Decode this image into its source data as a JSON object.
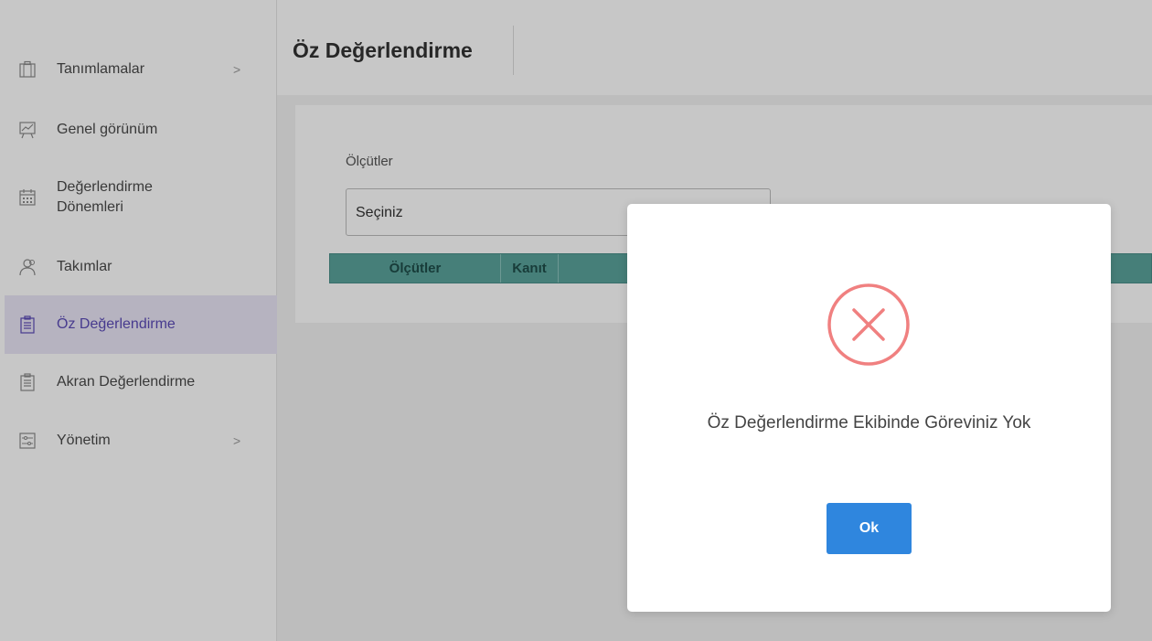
{
  "sidebar": {
    "items": [
      {
        "label": "Tanımlamalar",
        "icon": "briefcase-icon",
        "has_chevron": true
      },
      {
        "label": "Genel görünüm",
        "icon": "chart-board-icon",
        "has_chevron": false
      },
      {
        "label": "Değerlendirme Dönemleri",
        "icon": "calendar-icon",
        "has_chevron": false
      },
      {
        "label": "Takımlar",
        "icon": "team-icon",
        "has_chevron": false
      },
      {
        "label": "Öz Değerlendirme",
        "icon": "clipboard-list-icon",
        "has_chevron": false,
        "active": true
      },
      {
        "label": "Akran Değerlendirme",
        "icon": "clipboard-list-icon",
        "has_chevron": false
      },
      {
        "label": "Yönetim",
        "icon": "sliders-icon",
        "has_chevron": true
      }
    ],
    "chevron": ">"
  },
  "header": {
    "title": "Öz Değerlendirme"
  },
  "form": {
    "field_label": "Ölçütler",
    "select_value": "Seçiniz"
  },
  "table": {
    "columns": [
      "Ölçütler",
      "Kanıt"
    ]
  },
  "modal": {
    "message": "Öz Değerlendirme Ekibinde Göreviniz Yok",
    "ok_label": "Ok",
    "icon": "error-x-icon"
  },
  "colors": {
    "accent": "#5b4bb7",
    "table_header": "#5aa39c",
    "ok_button": "#2f86de",
    "error_icon": "#f08080"
  }
}
